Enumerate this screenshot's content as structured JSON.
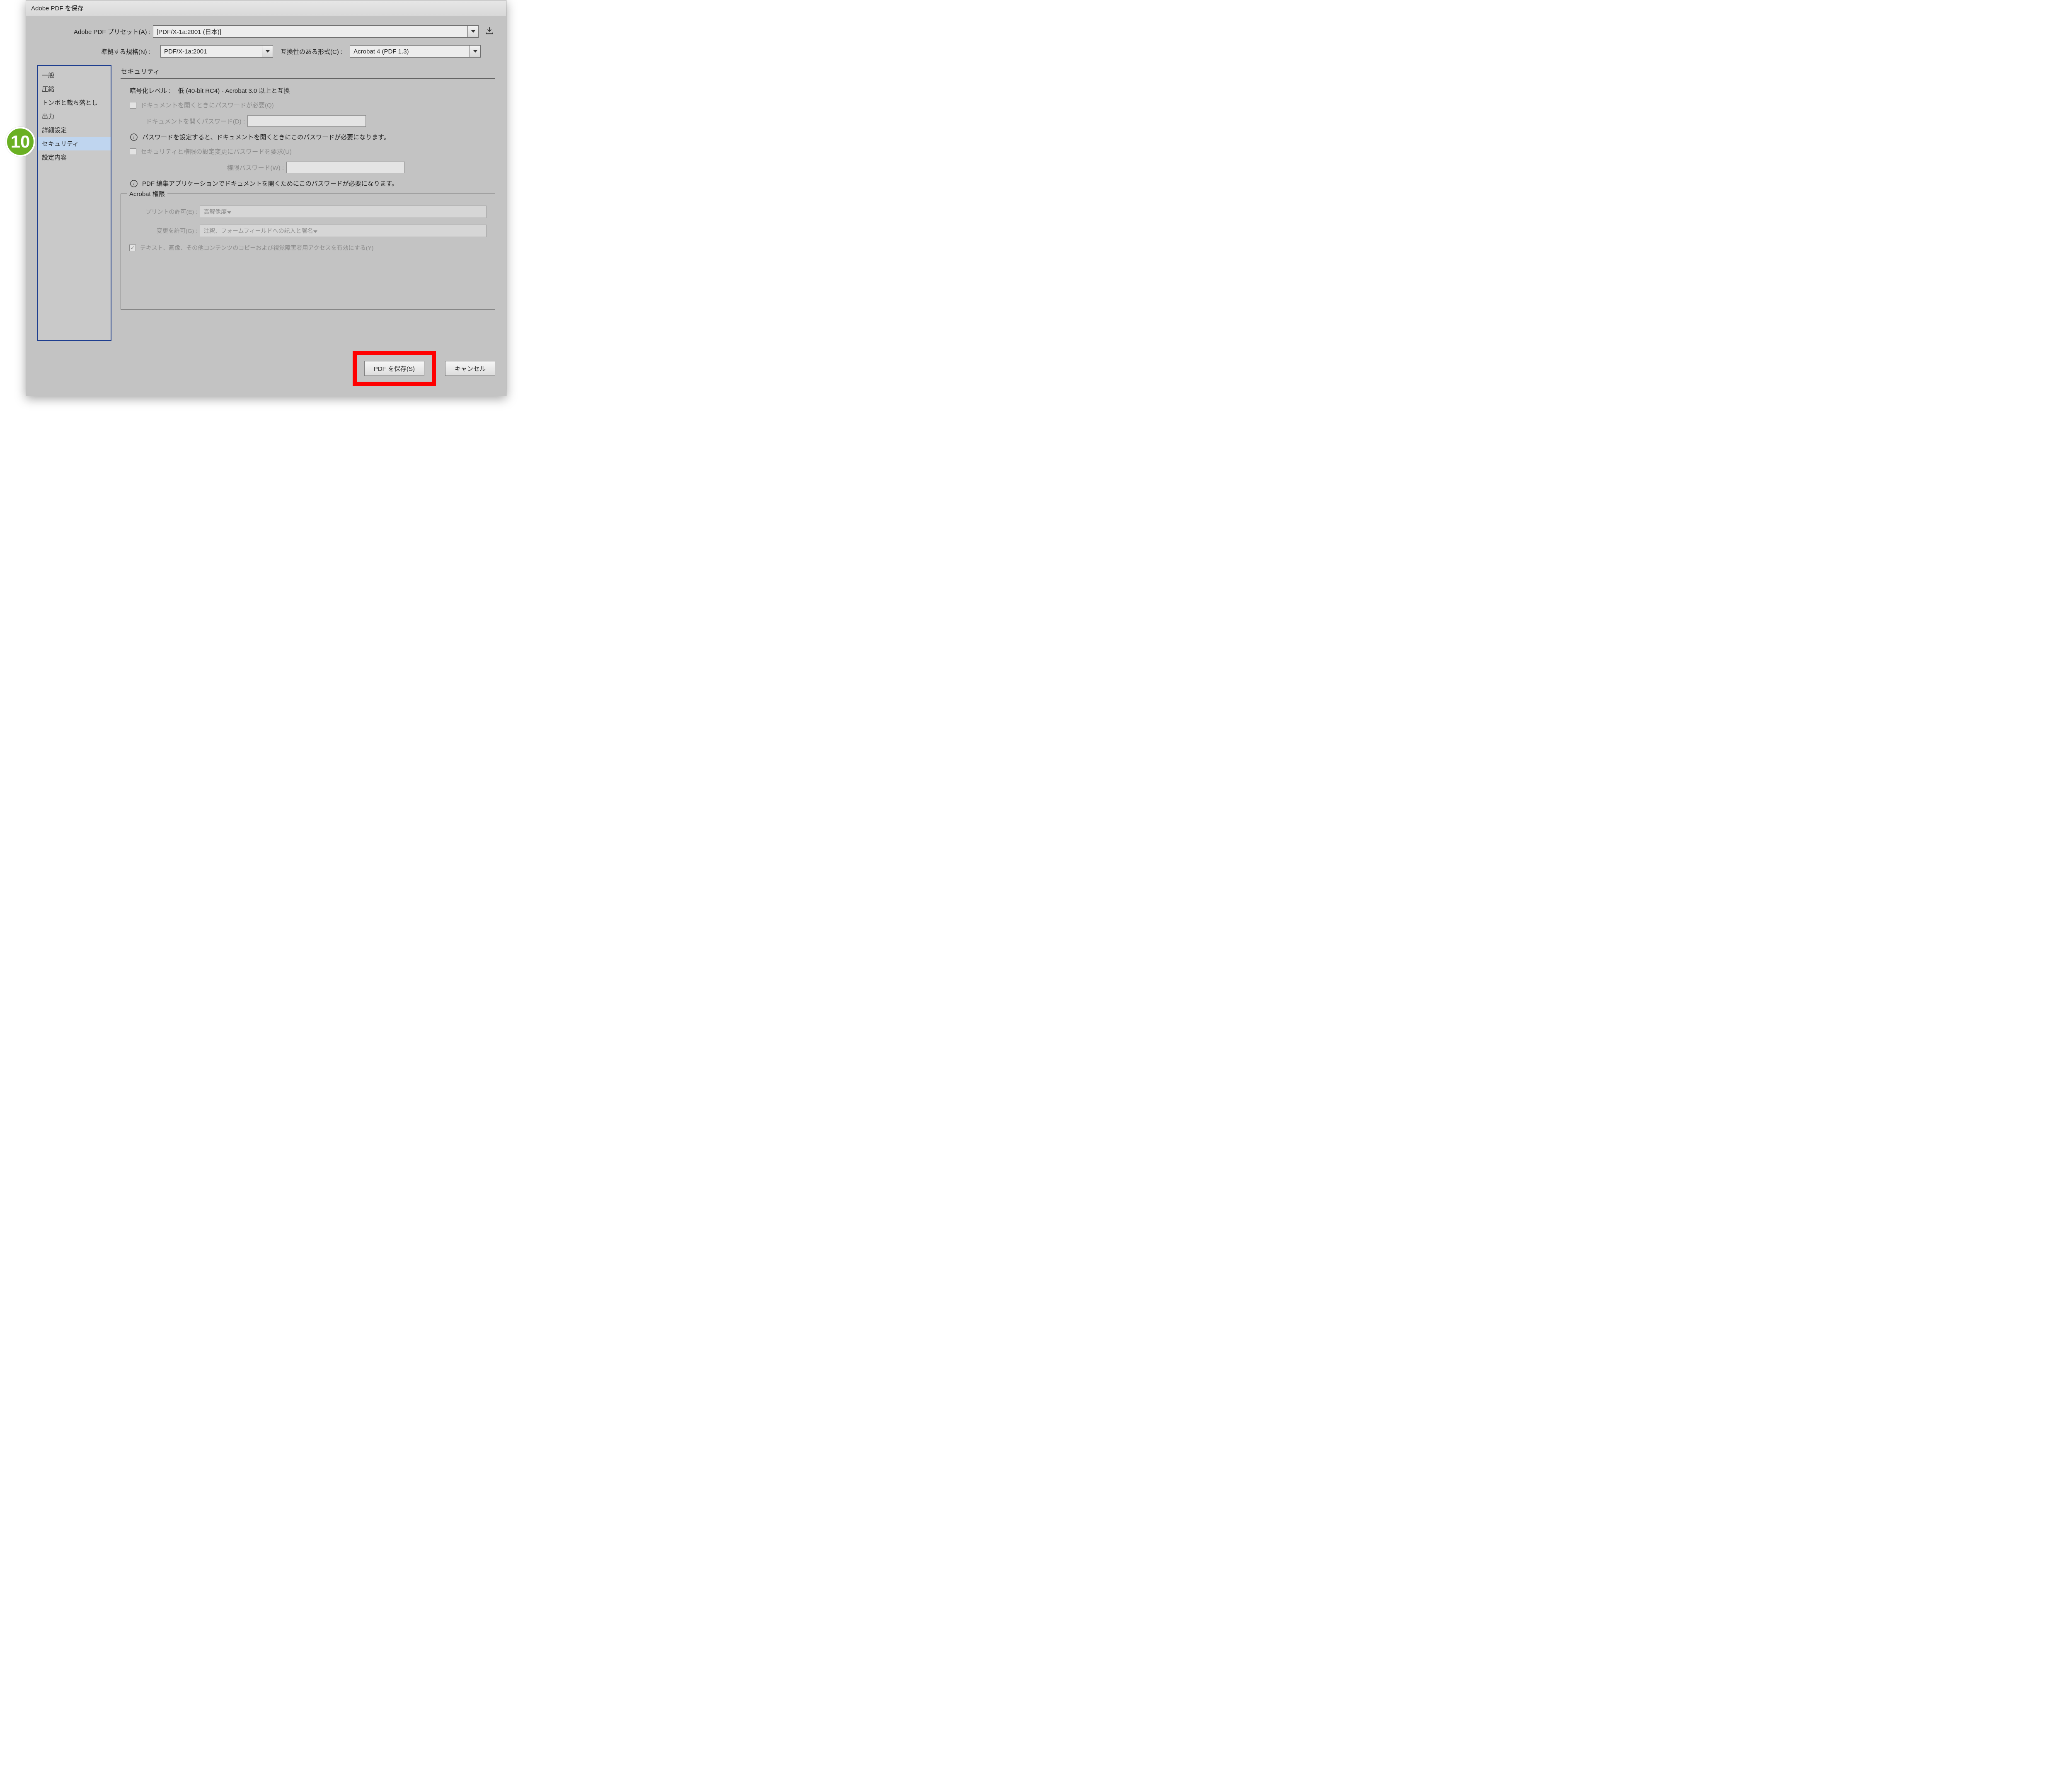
{
  "callout": "10",
  "dialog": {
    "title": "Adobe PDF を保存",
    "top": {
      "preset_label": "Adobe PDF プリセット(A) :",
      "preset_value": "[PDF/X-1a:2001 (日本)]",
      "standard_label": "準拠する規格(N) :",
      "standard_value": "PDF/X-1a:2001",
      "compat_label": "互換性のある形式(C) :",
      "compat_value": "Acrobat 4 (PDF 1.3)"
    },
    "sidebar": {
      "items": [
        "一般",
        "圧縮",
        "トンボと裁ち落とし",
        "出力",
        "詳細設定",
        "セキュリティ",
        "設定内容"
      ],
      "selected_index": 5
    },
    "security": {
      "section_title": "セキュリティ",
      "encryption_label": "暗号化レベル :",
      "encryption_value": "低 (40-bit RC4) - Acrobat 3.0 以上と互換",
      "open_pw_checkbox": "ドキュメントを開くときにパスワードが必要(Q)",
      "open_pw_label": "ドキュメントを開くパスワード(D) :",
      "open_pw_info": "パスワードを設定すると、ドキュメントを開くときにこのパスワードが必要になります。",
      "perm_pw_checkbox": "セキュリティと権限の設定変更にパスワードを要求(U)",
      "perm_pw_label": "権限パスワード(W) :",
      "perm_pw_info": "PDF 編集アプリケーションでドキュメントを開くためにこのパスワードが必要になります。",
      "acrobat_perm_legend": "Acrobat 権限",
      "print_label": "プリントの許可(E) :",
      "print_value": "高解像度",
      "change_label": "変更を許可(G) :",
      "change_value": "注釈、フォームフィールドへの記入と署名",
      "enable_copy": "テキスト、画像、その他コンテンツのコピーおよび視覚障害者用アクセスを有効にする(Y)"
    },
    "footer": {
      "save": "PDF を保存(S)",
      "cancel": "キャンセル"
    }
  }
}
